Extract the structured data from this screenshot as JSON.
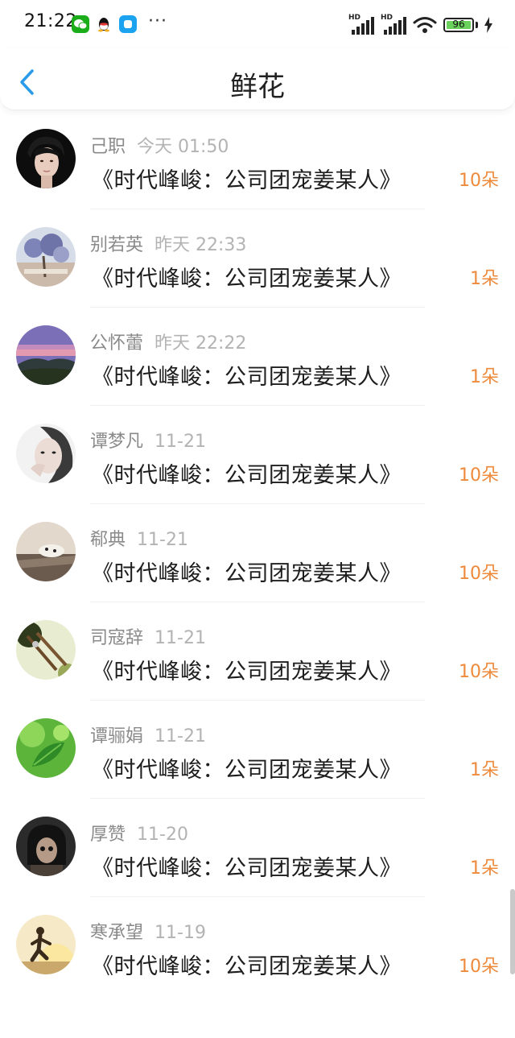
{
  "status_bar": {
    "time": "21:22",
    "battery": "96",
    "icons": [
      "wechat-icon",
      "qq-icon",
      "app-icon",
      "more-dots-icon",
      "hd-signal-icon",
      "hd-signal-icon",
      "wifi-icon",
      "battery-icon",
      "charging-icon"
    ]
  },
  "header": {
    "title": "鲜花",
    "back_icon": "chevron-left-icon"
  },
  "colors": {
    "accent_blue": "#2a9be8",
    "count_orange": "#ee8a3b",
    "name_gray": "#8a8a8a",
    "time_gray": "#b3b3b3"
  },
  "flowers": [
    {
      "name": "己职",
      "time": "今天 01:50",
      "book": "《时代峰峻：公司团宠姜某人》",
      "count": "10朵"
    },
    {
      "name": "别若英",
      "time": "昨天 22:33",
      "book": "《时代峰峻：公司团宠姜某人》",
      "count": "1朵"
    },
    {
      "name": "公怀蕾",
      "time": "昨天 22:22",
      "book": "《时代峰峻：公司团宠姜某人》",
      "count": "1朵"
    },
    {
      "name": "谭梦凡",
      "time": "11-21",
      "book": "《时代峰峻：公司团宠姜某人》",
      "count": "10朵"
    },
    {
      "name": "郗典",
      "time": "11-21",
      "book": "《时代峰峻：公司团宠姜某人》",
      "count": "10朵"
    },
    {
      "name": "司寇辞",
      "time": "11-21",
      "book": "《时代峰峻：公司团宠姜某人》",
      "count": "10朵"
    },
    {
      "name": "谭骊娟",
      "time": "11-21",
      "book": "《时代峰峻：公司团宠姜某人》",
      "count": "1朵"
    },
    {
      "name": "厚赞",
      "time": "11-20",
      "book": "《时代峰峻：公司团宠姜某人》",
      "count": "1朵"
    },
    {
      "name": "寒承望",
      "time": "11-19",
      "book": "《时代峰峻：公司团宠姜某人》",
      "count": "10朵"
    }
  ]
}
